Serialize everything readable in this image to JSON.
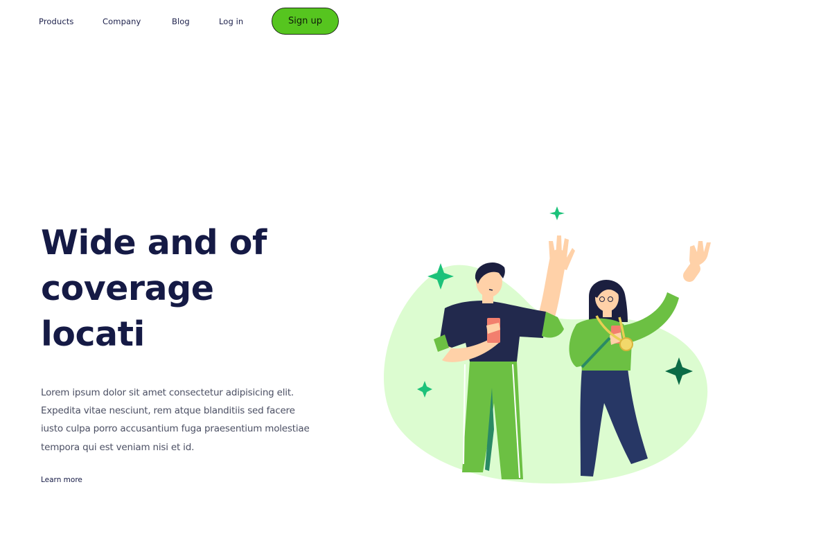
{
  "nav": {
    "items": [
      {
        "label": "Products"
      },
      {
        "label": "Company"
      },
      {
        "label": "Blog"
      },
      {
        "label": "Log in"
      }
    ],
    "signup_label": "Sign up"
  },
  "hero": {
    "title_lines": [
      "Wide and of",
      "coverage",
      "locati"
    ],
    "text": "Lorem ipsum dolor sit amet consectetur adipisicing elit. Expedita vitae nesciunt, rem atque blanditiis sed facere iusto culpa porro accusantium fuga praesentium molestiae tempora qui est veniam nisi et id.",
    "learn_more": "Learn more"
  },
  "colors": {
    "accent": "#56c51f",
    "title": "#151a45",
    "body_text": "#4b4f63",
    "blob": "#dcfcd0",
    "sparkle_green": "#1cc27a",
    "sparkle_dark": "#0b6b46"
  }
}
